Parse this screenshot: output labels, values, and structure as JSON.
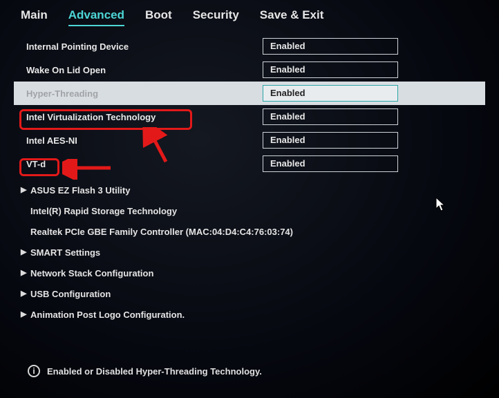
{
  "tabs": {
    "main": "Main",
    "advanced": "Advanced",
    "boot": "Boot",
    "security": "Security",
    "save_exit": "Save & Exit"
  },
  "settings": {
    "internal_pointing": {
      "label": "Internal Pointing Device",
      "value": "Enabled"
    },
    "wake_lid": {
      "label": "Wake On Lid Open",
      "value": "Enabled"
    },
    "hyper_threading": {
      "label": "Hyper-Threading",
      "value": "Enabled"
    },
    "intel_vt": {
      "label": "Intel Virtualization Technology",
      "value": "Enabled"
    },
    "intel_aes": {
      "label": "Intel AES-NI",
      "value": "Enabled"
    },
    "vt_d": {
      "label": "VT-d",
      "value": "Enabled"
    }
  },
  "subitems": {
    "ezflash": "ASUS EZ Flash 3 Utility",
    "irst": "Intel(R) Rapid Storage Technology",
    "realtek": "Realtek PCIe GBE Family Controller (MAC:04:D4:C4:76:03:74)",
    "smart": "SMART Settings",
    "netstack": "Network Stack Configuration",
    "usb": "USB Configuration",
    "anim": "Animation Post Logo Configuration."
  },
  "footer": {
    "help": "Enabled or Disabled Hyper-Threading Technology."
  },
  "annotation": {
    "highlight_row": "intel_vt",
    "highlight_row_2": "vt_d"
  }
}
